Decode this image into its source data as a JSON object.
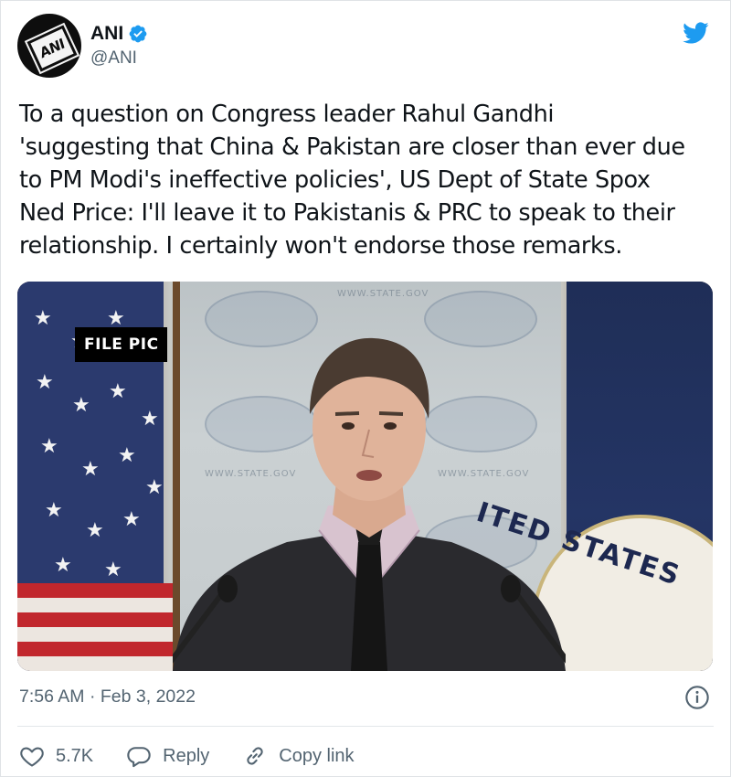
{
  "author": {
    "avatar_logo_text": "ANI",
    "display_name": "ANI",
    "verified": true,
    "handle": "@ANI"
  },
  "icons": {
    "platform": "twitter-bird-icon",
    "verified": "verified-badge-icon",
    "info": "info-icon",
    "like": "heart-icon",
    "reply": "reply-icon",
    "copy_link": "link-icon"
  },
  "tweet": {
    "lines": [
      "To a question on Congress leader Rahul Gandhi",
      "'suggesting that China & Pakistan are closer than ever due",
      "to PM Modi's ineffective policies', US Dept of State Spox",
      "Ned Price: I'll leave it to Pakistanis & PRC to speak to their",
      "relationship. I certainly won't endorse those remarks."
    ],
    "timestamp": "7:56 AM · Feb 3, 2022"
  },
  "media": {
    "label": "FILE PIC",
    "backdrop_text": "WWW.STATE.GOV",
    "seal_text": "ITED STATES"
  },
  "actions": {
    "like_count": "5.7K",
    "reply_label": "Reply",
    "copy_link_label": "Copy link"
  },
  "colors": {
    "twitter_blue": "#1d9bf0",
    "text_primary": "#0f1419",
    "text_secondary": "#536471",
    "divider": "#e3e7ea"
  }
}
